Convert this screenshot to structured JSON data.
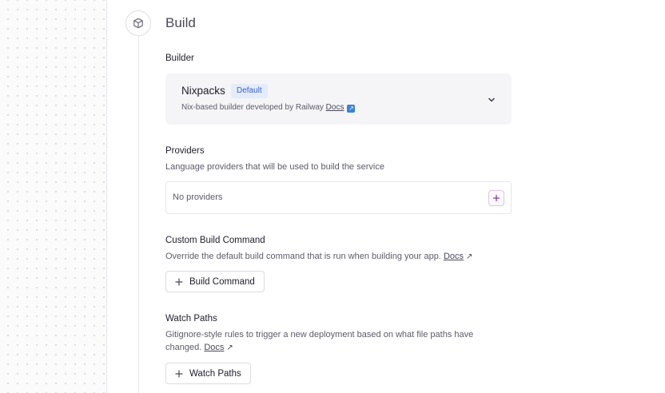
{
  "section": {
    "title": "Build",
    "icon": "package-icon"
  },
  "builder": {
    "label": "Builder",
    "name": "Nixpacks",
    "badge": "Default",
    "description": "Nix-based builder developed by Railway",
    "docs_label": "Docs",
    "chevron_icon": "chevron-down-icon",
    "colors": {
      "badge_bg": "#e4ebfb",
      "badge_text": "#3a64c9",
      "card_bg": "#f5f5f7"
    }
  },
  "providers": {
    "label": "Providers",
    "description": "Language providers that will be used to build the service",
    "empty_text": "No providers",
    "add_icon": "plus-icon"
  },
  "custom_build": {
    "label": "Custom Build Command",
    "description": "Override the default build command that is run when building your app.",
    "docs_label": "Docs",
    "button_label": "Build Command"
  },
  "watch_paths": {
    "label": "Watch Paths",
    "description_line1": "Gitignore-style rules to trigger a new deployment based on what file paths have",
    "description_line2": "changed.",
    "docs_label": "Docs",
    "button_label": "Watch Paths"
  }
}
